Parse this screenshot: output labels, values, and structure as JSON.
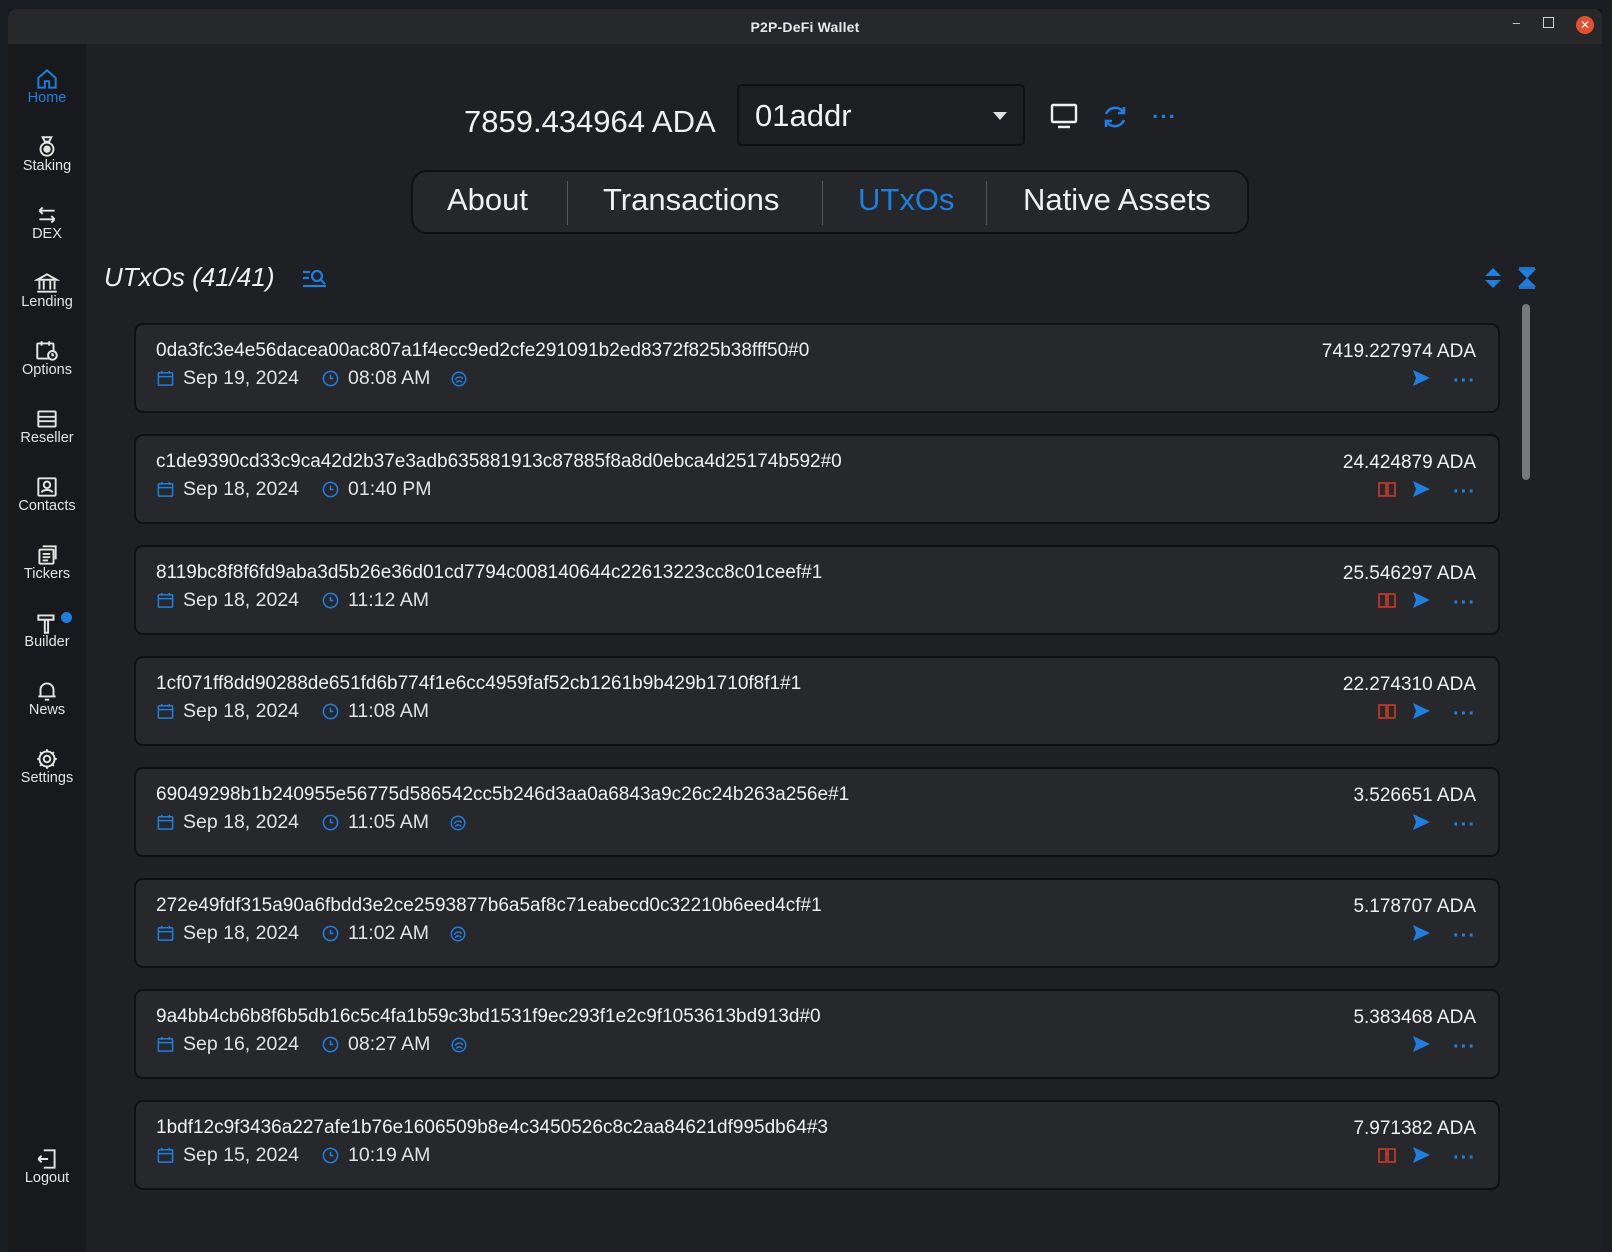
{
  "window": {
    "title": "P2P-DeFi Wallet"
  },
  "sidebar": {
    "items": [
      {
        "label": "Home",
        "icon": "home-icon",
        "active": true
      },
      {
        "label": "Staking",
        "icon": "medal-icon"
      },
      {
        "label": "DEX",
        "icon": "swap-arrows-icon"
      },
      {
        "label": "Lending",
        "icon": "bank-icon"
      },
      {
        "label": "Options",
        "icon": "calendar-clock-icon"
      },
      {
        "label": "Reseller",
        "icon": "store-icon"
      },
      {
        "label": "Contacts",
        "icon": "contact-card-icon"
      },
      {
        "label": "Tickers",
        "icon": "tickers-icon"
      },
      {
        "label": "Builder",
        "icon": "hammer-icon",
        "badge": true
      },
      {
        "label": "News",
        "icon": "bell-icon"
      },
      {
        "label": "Settings",
        "icon": "gear-icon"
      }
    ],
    "logout": {
      "label": "Logout",
      "icon": "logout-icon"
    }
  },
  "header": {
    "balance": "7859.434964 ADA",
    "address": "01addr"
  },
  "tabs": [
    {
      "label": "About"
    },
    {
      "label": "Transactions"
    },
    {
      "label": "UTxOs",
      "active": true
    },
    {
      "label": "Native Assets"
    }
  ],
  "section": {
    "title": "UTxOs (41/41)"
  },
  "accent_color": "#1e7fe0",
  "utxos": [
    {
      "hash": "0da3fc3e4e56dacea00ac807a1f4ecc9ed2cfe291091b2ed8372f825b38fff50#0",
      "date": "Sep 19, 2024",
      "time": "08:08 AM",
      "amount": "7419.227974 ADA",
      "staked": true,
      "book": false
    },
    {
      "hash": "c1de9390cd33c9ca42d2b37e3adb635881913c87885f8a8d0ebca4d25174b592#0",
      "date": "Sep 18, 2024",
      "time": "01:40 PM",
      "amount": "24.424879 ADA",
      "staked": false,
      "book": true
    },
    {
      "hash": "8119bc8f8f6fd9aba3d5b26e36d01cd7794c008140644c22613223cc8c01ceef#1",
      "date": "Sep 18, 2024",
      "time": "11:12 AM",
      "amount": "25.546297 ADA",
      "staked": false,
      "book": true
    },
    {
      "hash": "1cf071ff8dd90288de651fd6b774f1e6cc4959faf52cb1261b9b429b1710f8f1#1",
      "date": "Sep 18, 2024",
      "time": "11:08 AM",
      "amount": "22.274310 ADA",
      "staked": false,
      "book": true
    },
    {
      "hash": "69049298b1b240955e56775d586542cc5b246d3aa0a6843a9c26c24b263a256e#1",
      "date": "Sep 18, 2024",
      "time": "11:05 AM",
      "amount": "3.526651 ADA",
      "staked": true,
      "book": false
    },
    {
      "hash": "272e49fdf315a90a6fbdd3e2ce2593877b6a5af8c71eabecd0c32210b6eed4cf#1",
      "date": "Sep 18, 2024",
      "time": "11:02 AM",
      "amount": "5.178707 ADA",
      "staked": true,
      "book": false
    },
    {
      "hash": "9a4bb4cb6b8f6b5db16c5c4fa1b59c3bd1531f9ec293f1e2c9f1053613bd913d#0",
      "date": "Sep 16, 2024",
      "time": "08:27 AM",
      "amount": "5.383468 ADA",
      "staked": true,
      "book": false
    },
    {
      "hash": "1bdf12c9f3436a227afe1b76e1606509b8e4c3450526c8c2aa84621df995db64#3",
      "date": "Sep 15, 2024",
      "time": "10:19 AM",
      "amount": "7.971382 ADA",
      "staked": false,
      "book": true
    }
  ]
}
